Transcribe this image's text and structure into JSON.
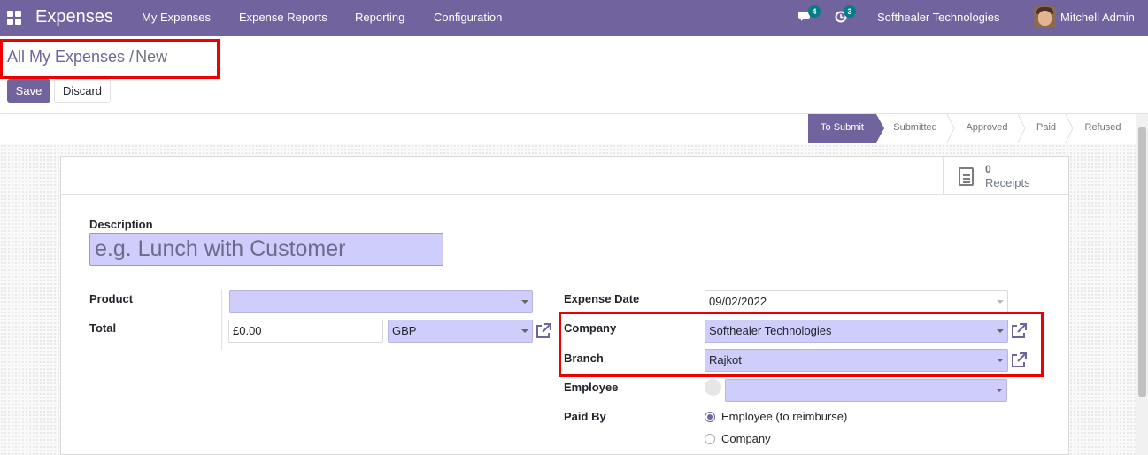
{
  "navbar": {
    "app_name": "Expenses",
    "menu": [
      "My Expenses",
      "Expense Reports",
      "Reporting",
      "Configuration"
    ],
    "messages_count": "4",
    "activities_count": "3",
    "company": "Softhealer Technologies",
    "user": "Mitchell Admin",
    "color": "#71639e"
  },
  "breadcrumb": {
    "parent": "All My Expenses",
    "separator": "/",
    "current": "New"
  },
  "buttons": {
    "save": "Save",
    "discard": "Discard"
  },
  "statusbar": {
    "stages": [
      "To Submit",
      "Submitted",
      "Approved",
      "Paid",
      "Refused"
    ],
    "active": "To Submit"
  },
  "smart_button": {
    "value": "0",
    "label": "Receipts",
    "icon": "document-icon"
  },
  "form": {
    "description_label": "Description",
    "description_placeholder": "e.g. Lunch with Customer",
    "product_label": "Product",
    "product_value": "",
    "total_label": "Total",
    "total_value": "£0.00",
    "currency_value": "GBP",
    "expense_date_label": "Expense Date",
    "expense_date_value": "09/02/2022",
    "company_label": "Company",
    "company_value": "Softhealer Technologies",
    "branch_label": "Branch",
    "branch_value": "Rajkot",
    "employee_label": "Employee",
    "employee_value": "",
    "paid_by_label": "Paid By",
    "paid_by_options": [
      "Employee (to reimburse)",
      "Company"
    ],
    "paid_by_selected": "Employee (to reimburse)"
  },
  "colors": {
    "accent": "#71639e",
    "field_fill": "#cfcdfb",
    "highlight": "#ee0000"
  }
}
